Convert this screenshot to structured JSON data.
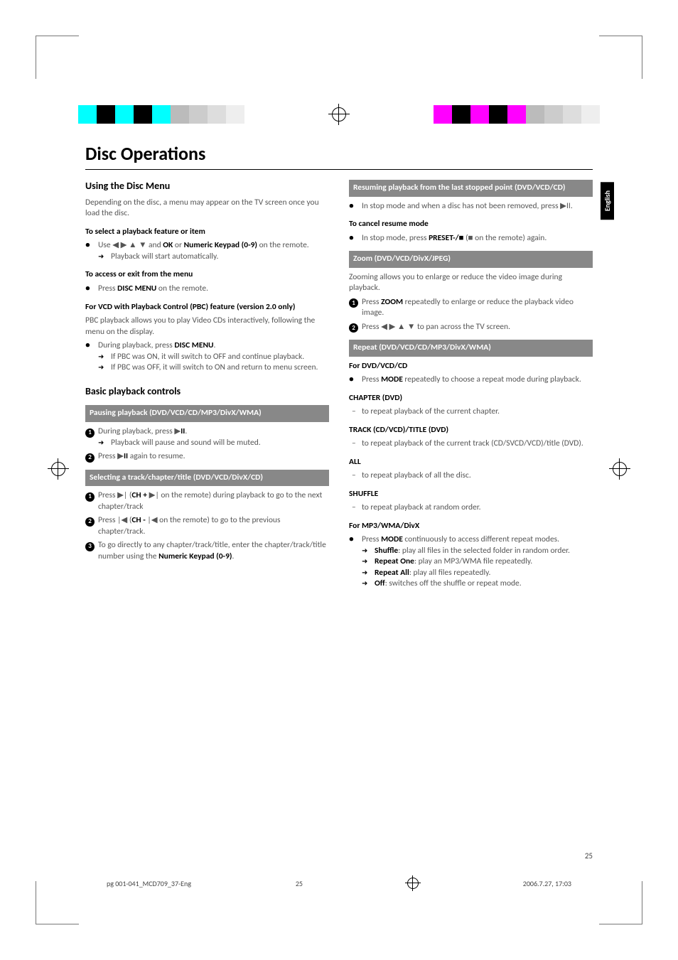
{
  "page_title": "Disc Operations",
  "lang_tab": "English",
  "page_number": "25",
  "footer": {
    "file": "pg 001-041_MCD709_37-Eng",
    "page": "25",
    "timestamp": "2006.7.27, 17:03"
  },
  "col1": {
    "h2_1": "Using the Disc Menu",
    "p1": "Depending on the disc, a menu may appear on the TV screen once you load the disc.",
    "h3_1": "To select a playback feature or item",
    "b1_pre": "Use ◀ ▶ ▲ ▼ and ",
    "b1_bold1": "OK",
    "b1_mid": " or ",
    "b1_bold2": "Numeric Keypad (0-9)",
    "b1_post": " on the remote.",
    "b1_arrow": "Playback will start automatically.",
    "h3_2": "To access or exit from the menu",
    "b2_pre": "Press ",
    "b2_bold": "DISC MENU",
    "b2_post": " on the remote.",
    "h3_3": "For VCD with Playback Control (PBC) feature (version 2.0 only)",
    "p2": "PBC playback allows you to play Video CDs interactively, following the menu on the display.",
    "b3_pre": "During playback, press ",
    "b3_bold": "DISC MENU",
    "b3_post": ".",
    "b3_arrow1": "If PBC was ON, it will switch to OFF and continue playback.",
    "b3_arrow2": "If PBC was OFF, it will switch to ON and return to menu screen.",
    "h2_2": "Basic playback controls",
    "box1": "Pausing playback (DVD/VCD/CD/MP3/DivX/WMA)",
    "n1_pre": "During playback, press  ▶",
    "n1_bold": "II",
    "n1_post": ".",
    "n1_arrow": "Playback will pause and sound will be muted.",
    "n2_pre": "Press  ▶",
    "n2_bold": "II",
    "n2_post": " again to resume.",
    "box2": "Selecting a track/chapter/title (DVD/VCD/DivX/CD)",
    "n3_pre": "Press ▶| (",
    "n3_bold": "CH +",
    "n3_post": " ▶| on the remote) during playback to go to the next chapter/track",
    "n4_pre": "Press |◀ (",
    "n4_bold": "CH -",
    "n4_post": " |◀ on the remote) to go to the previous chapter/track.",
    "n5_pre": "To go directly to any chapter/track/title, enter the chapter/track/title number using the ",
    "n5_bold": "Numeric Keypad (0-9)",
    "n5_post": "."
  },
  "col2": {
    "box1": "Resuming playback from the last stopped point (DVD/VCD/CD)",
    "b1": "In stop mode and when a disc has not been removed, press ▶II.",
    "h3_1": "To cancel resume mode",
    "b2_pre": "In stop mode, press ",
    "b2_bold": "PRESET-/■",
    "b2_post": " (■ on the remote) again.",
    "box2": "Zoom (DVD/VCD/DivX/JPEG)",
    "p1": "Zooming allows you to enlarge or reduce the video image during playback.",
    "n1_pre": "Press ",
    "n1_bold": "ZOOM",
    "n1_post": " repeatedly to enlarge or reduce the playback video image.",
    "n2": "Press ◀ ▶ ▲ ▼ to pan across the TV screen.",
    "box3": "Repeat (DVD/VCD/CD/MP3/DivX/WMA)",
    "h3_2": "For DVD/VCD/CD",
    "b3_pre": "Press ",
    "b3_bold": "MODE",
    "b3_post": " repeatedly to choose a repeat mode during playback.",
    "h3_3": "CHAPTER (DVD)",
    "d1": "to repeat playback of the current chapter.",
    "h3_4": "TRACK (CD/VCD)/TITLE (DVD)",
    "d2": "to repeat playback of the current track (CD/SVCD/VCD)/title (DVD).",
    "h3_5": "ALL",
    "d3": "to repeat playback of all the disc.",
    "h3_6": "SHUFFLE",
    "d4": "to repeat playback at random order.",
    "h3_7": "For MP3/WMA/DivX",
    "b4_pre": "Press ",
    "b4_bold": "MODE",
    "b4_post": " continuously to access different repeat modes.",
    "a1_bold": "Shuffle",
    "a1_post": ": play all files in the selected folder in random order.",
    "a2_bold": "Repeat One",
    "a2_post": ": play an MP3/WMA file repeatedly.",
    "a3_bold": "Repeat All",
    "a3_post": ": play all files repeatedly.",
    "a4_bold": "Off",
    "a4_post": ": switches off the shuffle or repeat mode."
  }
}
